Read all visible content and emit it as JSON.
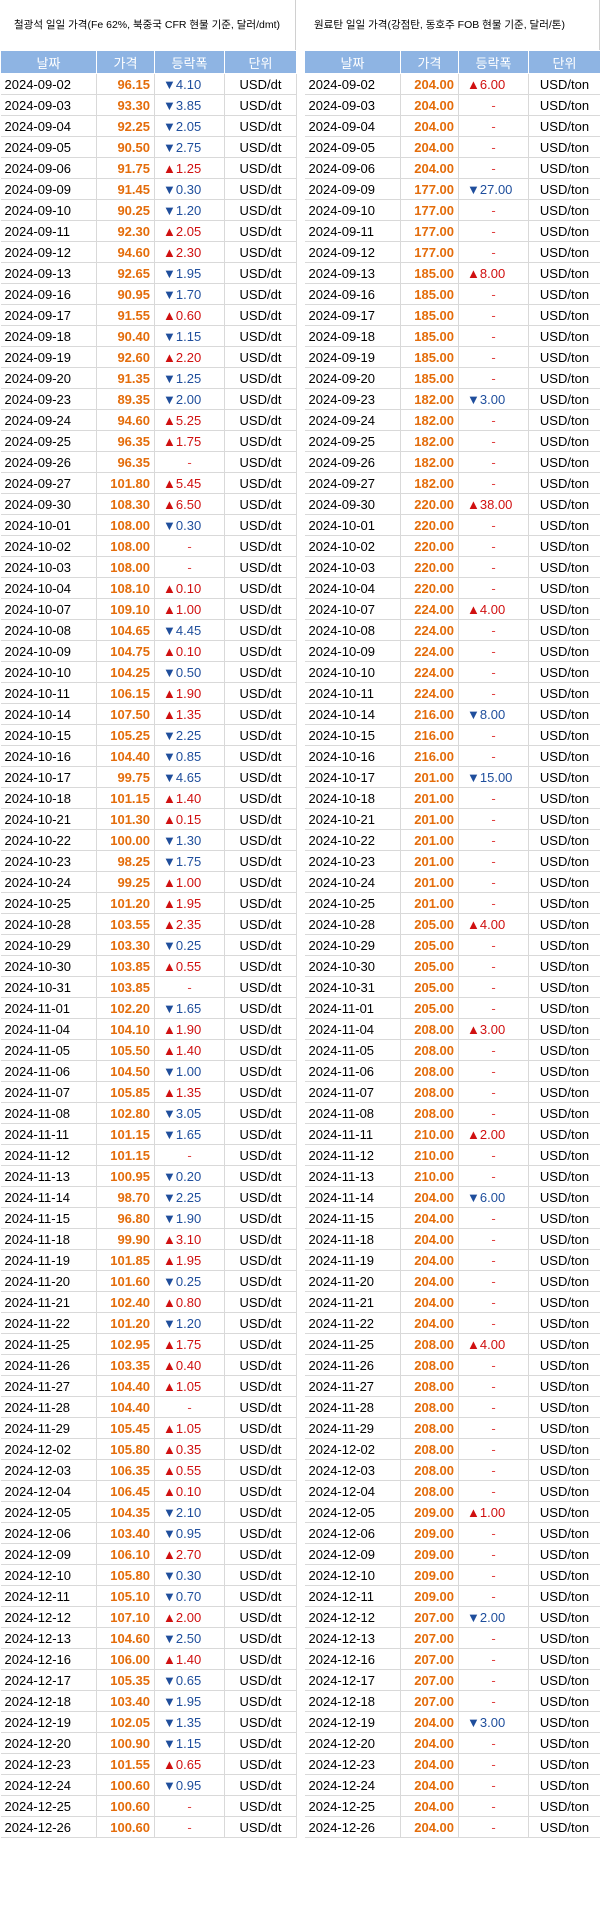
{
  "left": {
    "title": "철광석 일일 가격(Fe 62%, 북중국 CFR 현물 기준, 달러/dmt)",
    "headers": [
      "날짜",
      "가격",
      "등락폭",
      "단위"
    ],
    "rows": [
      [
        "2024-09-02",
        "96.15",
        "▼4.10",
        "USD/dt"
      ],
      [
        "2024-09-03",
        "93.30",
        "▼3.85",
        "USD/dt"
      ],
      [
        "2024-09-04",
        "92.25",
        "▼2.05",
        "USD/dt"
      ],
      [
        "2024-09-05",
        "90.50",
        "▼2.75",
        "USD/dt"
      ],
      [
        "2024-09-06",
        "91.75",
        "▲1.25",
        "USD/dt"
      ],
      [
        "2024-09-09",
        "91.45",
        "▼0.30",
        "USD/dt"
      ],
      [
        "2024-09-10",
        "90.25",
        "▼1.20",
        "USD/dt"
      ],
      [
        "2024-09-11",
        "92.30",
        "▲2.05",
        "USD/dt"
      ],
      [
        "2024-09-12",
        "94.60",
        "▲2.30",
        "USD/dt"
      ],
      [
        "2024-09-13",
        "92.65",
        "▼1.95",
        "USD/dt"
      ],
      [
        "2024-09-16",
        "90.95",
        "▼1.70",
        "USD/dt"
      ],
      [
        "2024-09-17",
        "91.55",
        "▲0.60",
        "USD/dt"
      ],
      [
        "2024-09-18",
        "90.40",
        "▼1.15",
        "USD/dt"
      ],
      [
        "2024-09-19",
        "92.60",
        "▲2.20",
        "USD/dt"
      ],
      [
        "2024-09-20",
        "91.35",
        "▼1.25",
        "USD/dt"
      ],
      [
        "2024-09-23",
        "89.35",
        "▼2.00",
        "USD/dt"
      ],
      [
        "2024-09-24",
        "94.60",
        "▲5.25",
        "USD/dt"
      ],
      [
        "2024-09-25",
        "96.35",
        "▲1.75",
        "USD/dt"
      ],
      [
        "2024-09-26",
        "96.35",
        "-",
        "USD/dt"
      ],
      [
        "2024-09-27",
        "101.80",
        "▲5.45",
        "USD/dt"
      ],
      [
        "2024-09-30",
        "108.30",
        "▲6.50",
        "USD/dt"
      ],
      [
        "2024-10-01",
        "108.00",
        "▼0.30",
        "USD/dt"
      ],
      [
        "2024-10-02",
        "108.00",
        "-",
        "USD/dt"
      ],
      [
        "2024-10-03",
        "108.00",
        "-",
        "USD/dt"
      ],
      [
        "2024-10-04",
        "108.10",
        "▲0.10",
        "USD/dt"
      ],
      [
        "2024-10-07",
        "109.10",
        "▲1.00",
        "USD/dt"
      ],
      [
        "2024-10-08",
        "104.65",
        "▼4.45",
        "USD/dt"
      ],
      [
        "2024-10-09",
        "104.75",
        "▲0.10",
        "USD/dt"
      ],
      [
        "2024-10-10",
        "104.25",
        "▼0.50",
        "USD/dt"
      ],
      [
        "2024-10-11",
        "106.15",
        "▲1.90",
        "USD/dt"
      ],
      [
        "2024-10-14",
        "107.50",
        "▲1.35",
        "USD/dt"
      ],
      [
        "2024-10-15",
        "105.25",
        "▼2.25",
        "USD/dt"
      ],
      [
        "2024-10-16",
        "104.40",
        "▼0.85",
        "USD/dt"
      ],
      [
        "2024-10-17",
        "99.75",
        "▼4.65",
        "USD/dt"
      ],
      [
        "2024-10-18",
        "101.15",
        "▲1.40",
        "USD/dt"
      ],
      [
        "2024-10-21",
        "101.30",
        "▲0.15",
        "USD/dt"
      ],
      [
        "2024-10-22",
        "100.00",
        "▼1.30",
        "USD/dt"
      ],
      [
        "2024-10-23",
        "98.25",
        "▼1.75",
        "USD/dt"
      ],
      [
        "2024-10-24",
        "99.25",
        "▲1.00",
        "USD/dt"
      ],
      [
        "2024-10-25",
        "101.20",
        "▲1.95",
        "USD/dt"
      ],
      [
        "2024-10-28",
        "103.55",
        "▲2.35",
        "USD/dt"
      ],
      [
        "2024-10-29",
        "103.30",
        "▼0.25",
        "USD/dt"
      ],
      [
        "2024-10-30",
        "103.85",
        "▲0.55",
        "USD/dt"
      ],
      [
        "2024-10-31",
        "103.85",
        "-",
        "USD/dt"
      ],
      [
        "2024-11-01",
        "102.20",
        "▼1.65",
        "USD/dt"
      ],
      [
        "2024-11-04",
        "104.10",
        "▲1.90",
        "USD/dt"
      ],
      [
        "2024-11-05",
        "105.50",
        "▲1.40",
        "USD/dt"
      ],
      [
        "2024-11-06",
        "104.50",
        "▼1.00",
        "USD/dt"
      ],
      [
        "2024-11-07",
        "105.85",
        "▲1.35",
        "USD/dt"
      ],
      [
        "2024-11-08",
        "102.80",
        "▼3.05",
        "USD/dt"
      ],
      [
        "2024-11-11",
        "101.15",
        "▼1.65",
        "USD/dt"
      ],
      [
        "2024-11-12",
        "101.15",
        "-",
        "USD/dt"
      ],
      [
        "2024-11-13",
        "100.95",
        "▼0.20",
        "USD/dt"
      ],
      [
        "2024-11-14",
        "98.70",
        "▼2.25",
        "USD/dt"
      ],
      [
        "2024-11-15",
        "96.80",
        "▼1.90",
        "USD/dt"
      ],
      [
        "2024-11-18",
        "99.90",
        "▲3.10",
        "USD/dt"
      ],
      [
        "2024-11-19",
        "101.85",
        "▲1.95",
        "USD/dt"
      ],
      [
        "2024-11-20",
        "101.60",
        "▼0.25",
        "USD/dt"
      ],
      [
        "2024-11-21",
        "102.40",
        "▲0.80",
        "USD/dt"
      ],
      [
        "2024-11-22",
        "101.20",
        "▼1.20",
        "USD/dt"
      ],
      [
        "2024-11-25",
        "102.95",
        "▲1.75",
        "USD/dt"
      ],
      [
        "2024-11-26",
        "103.35",
        "▲0.40",
        "USD/dt"
      ],
      [
        "2024-11-27",
        "104.40",
        "▲1.05",
        "USD/dt"
      ],
      [
        "2024-11-28",
        "104.40",
        "-",
        "USD/dt"
      ],
      [
        "2024-11-29",
        "105.45",
        "▲1.05",
        "USD/dt"
      ],
      [
        "2024-12-02",
        "105.80",
        "▲0.35",
        "USD/dt"
      ],
      [
        "2024-12-03",
        "106.35",
        "▲0.55",
        "USD/dt"
      ],
      [
        "2024-12-04",
        "106.45",
        "▲0.10",
        "USD/dt"
      ],
      [
        "2024-12-05",
        "104.35",
        "▼2.10",
        "USD/dt"
      ],
      [
        "2024-12-06",
        "103.40",
        "▼0.95",
        "USD/dt"
      ],
      [
        "2024-12-09",
        "106.10",
        "▲2.70",
        "USD/dt"
      ],
      [
        "2024-12-10",
        "105.80",
        "▼0.30",
        "USD/dt"
      ],
      [
        "2024-12-11",
        "105.10",
        "▼0.70",
        "USD/dt"
      ],
      [
        "2024-12-12",
        "107.10",
        "▲2.00",
        "USD/dt"
      ],
      [
        "2024-12-13",
        "104.60",
        "▼2.50",
        "USD/dt"
      ],
      [
        "2024-12-16",
        "106.00",
        "▲1.40",
        "USD/dt"
      ],
      [
        "2024-12-17",
        "105.35",
        "▼0.65",
        "USD/dt"
      ],
      [
        "2024-12-18",
        "103.40",
        "▼1.95",
        "USD/dt"
      ],
      [
        "2024-12-19",
        "102.05",
        "▼1.35",
        "USD/dt"
      ],
      [
        "2024-12-20",
        "100.90",
        "▼1.15",
        "USD/dt"
      ],
      [
        "2024-12-23",
        "101.55",
        "▲0.65",
        "USD/dt"
      ],
      [
        "2024-12-24",
        "100.60",
        "▼0.95",
        "USD/dt"
      ],
      [
        "2024-12-25",
        "100.60",
        "-",
        "USD/dt"
      ],
      [
        "2024-12-26",
        "100.60",
        "-",
        "USD/dt"
      ]
    ]
  },
  "right": {
    "title": "원료탄 일일 가격(강점탄, 동호주 FOB 현물 기준, 달러/톤)",
    "headers": [
      "날짜",
      "가격",
      "등락폭",
      "단위"
    ],
    "rows": [
      [
        "2024-09-02",
        "204.00",
        "▲6.00",
        "USD/ton"
      ],
      [
        "2024-09-03",
        "204.00",
        "-",
        "USD/ton"
      ],
      [
        "2024-09-04",
        "204.00",
        "-",
        "USD/ton"
      ],
      [
        "2024-09-05",
        "204.00",
        "-",
        "USD/ton"
      ],
      [
        "2024-09-06",
        "204.00",
        "-",
        "USD/ton"
      ],
      [
        "2024-09-09",
        "177.00",
        "▼27.00",
        "USD/ton"
      ],
      [
        "2024-09-10",
        "177.00",
        "-",
        "USD/ton"
      ],
      [
        "2024-09-11",
        "177.00",
        "-",
        "USD/ton"
      ],
      [
        "2024-09-12",
        "177.00",
        "-",
        "USD/ton"
      ],
      [
        "2024-09-13",
        "185.00",
        "▲8.00",
        "USD/ton"
      ],
      [
        "2024-09-16",
        "185.00",
        "-",
        "USD/ton"
      ],
      [
        "2024-09-17",
        "185.00",
        "-",
        "USD/ton"
      ],
      [
        "2024-09-18",
        "185.00",
        "-",
        "USD/ton"
      ],
      [
        "2024-09-19",
        "185.00",
        "-",
        "USD/ton"
      ],
      [
        "2024-09-20",
        "185.00",
        "-",
        "USD/ton"
      ],
      [
        "2024-09-23",
        "182.00",
        "▼3.00",
        "USD/ton"
      ],
      [
        "2024-09-24",
        "182.00",
        "-",
        "USD/ton"
      ],
      [
        "2024-09-25",
        "182.00",
        "-",
        "USD/ton"
      ],
      [
        "2024-09-26",
        "182.00",
        "-",
        "USD/ton"
      ],
      [
        "2024-09-27",
        "182.00",
        "-",
        "USD/ton"
      ],
      [
        "2024-09-30",
        "220.00",
        "▲38.00",
        "USD/ton"
      ],
      [
        "2024-10-01",
        "220.00",
        "-",
        "USD/ton"
      ],
      [
        "2024-10-02",
        "220.00",
        "-",
        "USD/ton"
      ],
      [
        "2024-10-03",
        "220.00",
        "-",
        "USD/ton"
      ],
      [
        "2024-10-04",
        "220.00",
        "-",
        "USD/ton"
      ],
      [
        "2024-10-07",
        "224.00",
        "▲4.00",
        "USD/ton"
      ],
      [
        "2024-10-08",
        "224.00",
        "-",
        "USD/ton"
      ],
      [
        "2024-10-09",
        "224.00",
        "-",
        "USD/ton"
      ],
      [
        "2024-10-10",
        "224.00",
        "-",
        "USD/ton"
      ],
      [
        "2024-10-11",
        "224.00",
        "-",
        "USD/ton"
      ],
      [
        "2024-10-14",
        "216.00",
        "▼8.00",
        "USD/ton"
      ],
      [
        "2024-10-15",
        "216.00",
        "-",
        "USD/ton"
      ],
      [
        "2024-10-16",
        "216.00",
        "-",
        "USD/ton"
      ],
      [
        "2024-10-17",
        "201.00",
        "▼15.00",
        "USD/ton"
      ],
      [
        "2024-10-18",
        "201.00",
        "-",
        "USD/ton"
      ],
      [
        "2024-10-21",
        "201.00",
        "-",
        "USD/ton"
      ],
      [
        "2024-10-22",
        "201.00",
        "-",
        "USD/ton"
      ],
      [
        "2024-10-23",
        "201.00",
        "-",
        "USD/ton"
      ],
      [
        "2024-10-24",
        "201.00",
        "-",
        "USD/ton"
      ],
      [
        "2024-10-25",
        "201.00",
        "-",
        "USD/ton"
      ],
      [
        "2024-10-28",
        "205.00",
        "▲4.00",
        "USD/ton"
      ],
      [
        "2024-10-29",
        "205.00",
        "-",
        "USD/ton"
      ],
      [
        "2024-10-30",
        "205.00",
        "-",
        "USD/ton"
      ],
      [
        "2024-10-31",
        "205.00",
        "-",
        "USD/ton"
      ],
      [
        "2024-11-01",
        "205.00",
        "-",
        "USD/ton"
      ],
      [
        "2024-11-04",
        "208.00",
        "▲3.00",
        "USD/ton"
      ],
      [
        "2024-11-05",
        "208.00",
        "-",
        "USD/ton"
      ],
      [
        "2024-11-06",
        "208.00",
        "-",
        "USD/ton"
      ],
      [
        "2024-11-07",
        "208.00",
        "-",
        "USD/ton"
      ],
      [
        "2024-11-08",
        "208.00",
        "-",
        "USD/ton"
      ],
      [
        "2024-11-11",
        "210.00",
        "▲2.00",
        "USD/ton"
      ],
      [
        "2024-11-12",
        "210.00",
        "-",
        "USD/ton"
      ],
      [
        "2024-11-13",
        "210.00",
        "-",
        "USD/ton"
      ],
      [
        "2024-11-14",
        "204.00",
        "▼6.00",
        "USD/ton"
      ],
      [
        "2024-11-15",
        "204.00",
        "-",
        "USD/ton"
      ],
      [
        "2024-11-18",
        "204.00",
        "-",
        "USD/ton"
      ],
      [
        "2024-11-19",
        "204.00",
        "-",
        "USD/ton"
      ],
      [
        "2024-11-20",
        "204.00",
        "-",
        "USD/ton"
      ],
      [
        "2024-11-21",
        "204.00",
        "-",
        "USD/ton"
      ],
      [
        "2024-11-22",
        "204.00",
        "-",
        "USD/ton"
      ],
      [
        "2024-11-25",
        "208.00",
        "▲4.00",
        "USD/ton"
      ],
      [
        "2024-11-26",
        "208.00",
        "-",
        "USD/ton"
      ],
      [
        "2024-11-27",
        "208.00",
        "-",
        "USD/ton"
      ],
      [
        "2024-11-28",
        "208.00",
        "-",
        "USD/ton"
      ],
      [
        "2024-11-29",
        "208.00",
        "-",
        "USD/ton"
      ],
      [
        "2024-12-02",
        "208.00",
        "-",
        "USD/ton"
      ],
      [
        "2024-12-03",
        "208.00",
        "-",
        "USD/ton"
      ],
      [
        "2024-12-04",
        "208.00",
        "-",
        "USD/ton"
      ],
      [
        "2024-12-05",
        "209.00",
        "▲1.00",
        "USD/ton"
      ],
      [
        "2024-12-06",
        "209.00",
        "-",
        "USD/ton"
      ],
      [
        "2024-12-09",
        "209.00",
        "-",
        "USD/ton"
      ],
      [
        "2024-12-10",
        "209.00",
        "-",
        "USD/ton"
      ],
      [
        "2024-12-11",
        "209.00",
        "-",
        "USD/ton"
      ],
      [
        "2024-12-12",
        "207.00",
        "▼2.00",
        "USD/ton"
      ],
      [
        "2024-12-13",
        "207.00",
        "-",
        "USD/ton"
      ],
      [
        "2024-12-16",
        "207.00",
        "-",
        "USD/ton"
      ],
      [
        "2024-12-17",
        "207.00",
        "-",
        "USD/ton"
      ],
      [
        "2024-12-18",
        "207.00",
        "-",
        "USD/ton"
      ],
      [
        "2024-12-19",
        "204.00",
        "▼3.00",
        "USD/ton"
      ],
      [
        "2024-12-20",
        "204.00",
        "-",
        "USD/ton"
      ],
      [
        "2024-12-23",
        "204.00",
        "-",
        "USD/ton"
      ],
      [
        "2024-12-24",
        "204.00",
        "-",
        "USD/ton"
      ],
      [
        "2024-12-25",
        "204.00",
        "-",
        "USD/ton"
      ],
      [
        "2024-12-26",
        "204.00",
        "-",
        "USD/ton"
      ]
    ]
  },
  "colors": {
    "header_bg": "#8eb4e3",
    "price": "#e46c0a",
    "up": "#d01010",
    "down": "#1f4e9c"
  }
}
